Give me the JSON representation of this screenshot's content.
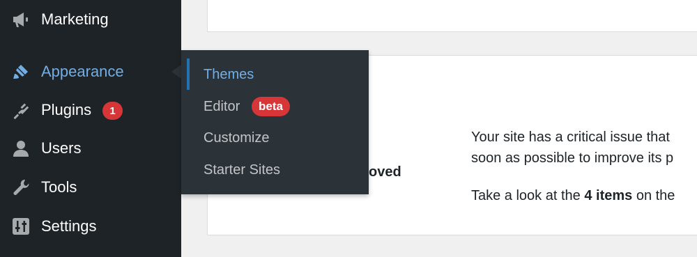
{
  "sidebar": {
    "items": [
      {
        "label": "Marketing",
        "icon": "megaphone-icon"
      },
      {
        "label": "Appearance",
        "icon": "paintbrush-icon",
        "current": true
      },
      {
        "label": "Plugins",
        "icon": "plug-icon",
        "badge": "1"
      },
      {
        "label": "Users",
        "icon": "user-icon"
      },
      {
        "label": "Tools",
        "icon": "wrench-icon"
      },
      {
        "label": "Settings",
        "icon": "settings-icon"
      }
    ]
  },
  "submenu": {
    "items": [
      {
        "label": "Themes",
        "active": true
      },
      {
        "label": "Editor",
        "badge": "beta"
      },
      {
        "label": "Customize"
      },
      {
        "label": "Starter Sites"
      }
    ]
  },
  "site_health": {
    "heading_fragment": "oved",
    "line1": "Your site has a critical issue that",
    "line2": "soon as possible to improve its p",
    "line3_prefix": "Take a look at the ",
    "line3_bold": "4 items",
    "line3_suffix": " on the"
  },
  "colors": {
    "sidebar_bg": "#1e2327",
    "submenu_bg": "#2c3338",
    "accent": "#72aee6",
    "badge": "#d63638",
    "content_bg": "#f0f0f1"
  }
}
